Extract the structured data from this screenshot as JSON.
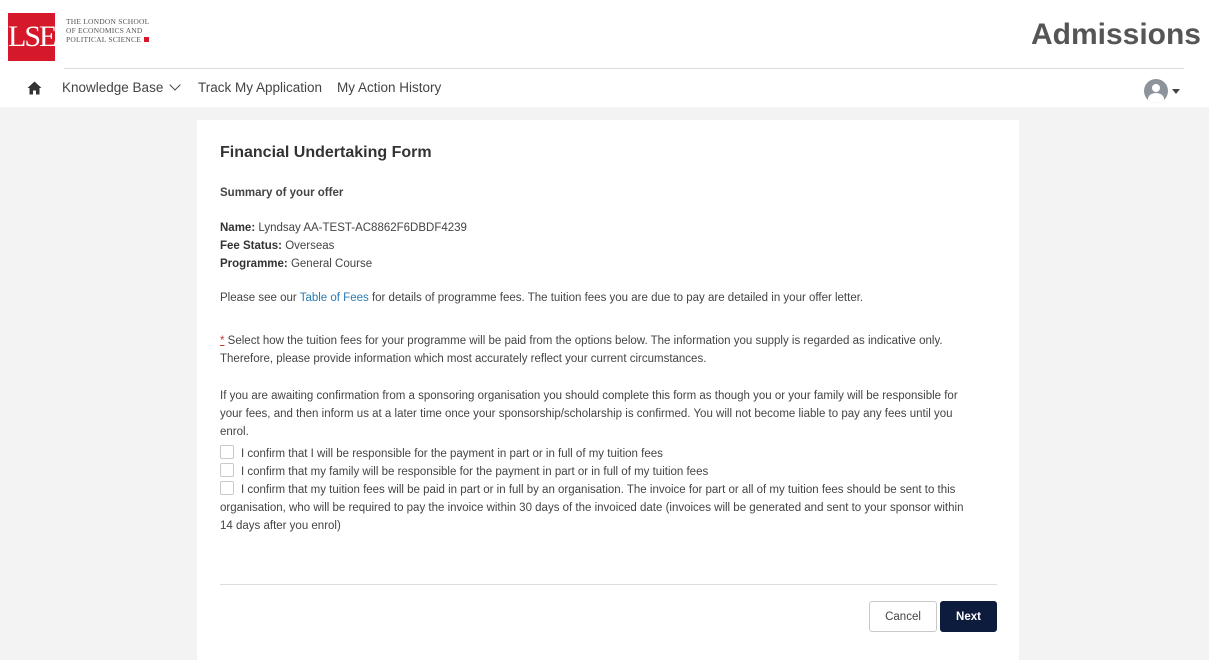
{
  "header": {
    "logo_mark": "LSE",
    "logo_lines": [
      "The London School",
      "of Economics and",
      "Political Science"
    ],
    "brand_title": "Admissions"
  },
  "nav": {
    "home_icon": "home-icon",
    "items": [
      "Knowledge Base",
      "Track My Application",
      "My Action History"
    ]
  },
  "form": {
    "title": "Financial Undertaking Form",
    "summary_heading": "Summary of your offer",
    "name_label": "Name:",
    "name_value": "Lyndsay AA-TEST-AC8862F6DBDF4239",
    "fee_status_label": "Fee Status:",
    "fee_status_value": "Overseas",
    "programme_label": "Programme:",
    "programme_value": "General Course",
    "fees_pre": "Please see our ",
    "fees_link": "Table of Fees",
    "fees_post": " for details of programme fees. The tuition fees you are due to pay are detailed in your offer letter.",
    "required_marker": "*",
    "instruction_line1": " Select how the tuition fees for your programme will be paid from the options below. The information you supply is regarded as indicative only.",
    "instruction_line2": "Therefore, please provide information which most accurately reflect your current circumstances.",
    "sponsor_line1": "If you are awaiting confirmation from a sponsoring organisation you should complete this form as though you or your family will be responsible for",
    "sponsor_line2": "your fees, and then inform us at a later time once your sponsorship/scholarship is confirmed. You will not become liable to pay any fees until you",
    "sponsor_line3": "enrol.",
    "options": [
      "I confirm that I will be responsible for the payment in part or in full of my tuition fees",
      "I confirm that my family will be responsible for the payment in part or in full of my tuition fees",
      "I confirm that my tuition fees will be paid in part or in full by an organisation. The invoice for part or all of my tuition fees should be sent to this"
    ],
    "option3_line2": "organisation, who will be required to pay the invoice within 30 days of the invoiced date (invoices will be generated and sent to your sponsor within",
    "option3_line3": "14 days after you enrol)",
    "cancel_label": "Cancel",
    "next_label": "Next"
  },
  "colors": {
    "brand_red": "#d6192a",
    "link_blue": "#2a7ab0",
    "next_button": "#0d1b3d",
    "page_bg": "#f3f3f3"
  }
}
